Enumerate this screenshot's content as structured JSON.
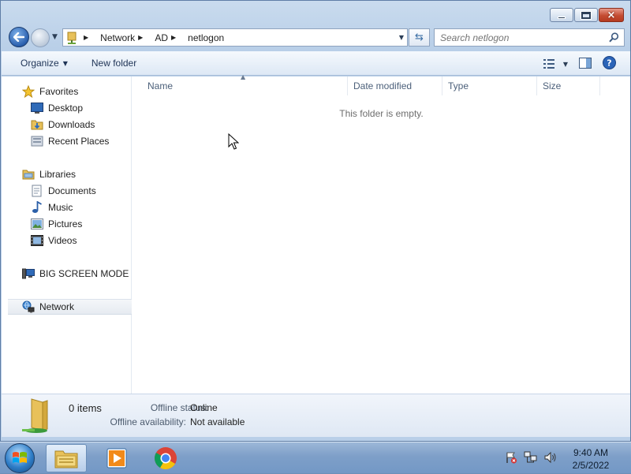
{
  "window": {
    "caption": {
      "minimize_glyph": "minimize-icon",
      "maximize_glyph": "maximize-icon",
      "close_glyph": "×"
    }
  },
  "address": {
    "crumbs": [
      "Network",
      "AD",
      "netlogon"
    ]
  },
  "search": {
    "placeholder": "Search netlogon"
  },
  "toolbar": {
    "organize_label": "Organize",
    "new_folder_label": "New folder"
  },
  "nav": {
    "favorites": {
      "label": "Favorites",
      "items": [
        {
          "label": "Desktop",
          "icon": "desktop-icon"
        },
        {
          "label": "Downloads",
          "icon": "downloads-icon"
        },
        {
          "label": "Recent Places",
          "icon": "recent-places-icon"
        }
      ]
    },
    "libraries": {
      "label": "Libraries",
      "items": [
        {
          "label": "Documents",
          "icon": "documents-icon"
        },
        {
          "label": "Music",
          "icon": "music-icon"
        },
        {
          "label": "Pictures",
          "icon": "pictures-icon"
        },
        {
          "label": "Videos",
          "icon": "videos-icon"
        }
      ]
    },
    "computer": {
      "label": "BIG SCREEN MODE"
    },
    "network": {
      "label": "Network"
    }
  },
  "files": {
    "columns": [
      "Name",
      "Date modified",
      "Type",
      "Size"
    ],
    "empty_message": "This folder is empty."
  },
  "details": {
    "count": "0 items",
    "offline_status_label": "Offline status:",
    "offline_status_value": "Online",
    "offline_availability_label": "Offline availability:",
    "offline_availability_value": "Not available"
  },
  "taskbar": {
    "clock_time": "9:40 AM",
    "clock_date": "2/5/2022"
  },
  "colors": {
    "accent": "#3a6ea5",
    "taskbar": "#7e9fc8",
    "close_button": "#c44c32"
  }
}
